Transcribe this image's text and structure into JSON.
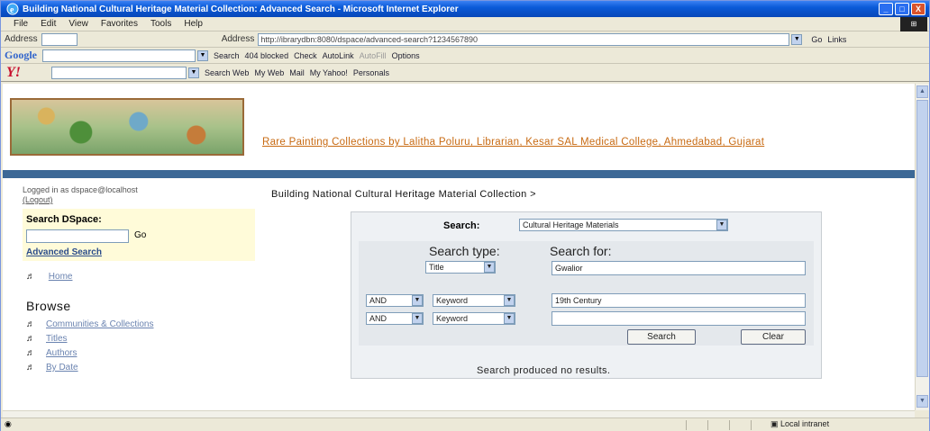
{
  "window": {
    "title": "Building National Cultural Heritage Material Collection: Advanced Search - Microsoft Internet Explorer",
    "buttons": [
      "_",
      "□",
      "X"
    ]
  },
  "menu": [
    "File",
    "Edit",
    "View",
    "Favorites",
    "Tools",
    "Help"
  ],
  "address": {
    "label": "Address",
    "url": "http://ibrarydbn:8080/dspace/advanced-search?1234567890",
    "go_label": "Go",
    "links_label": "Links"
  },
  "google_toolbar": {
    "brand": "Google",
    "items": [
      "Search",
      "404 blocked",
      "Check",
      "AutoLink",
      "AutoFill",
      "Options"
    ]
  },
  "yahoo_toolbar": {
    "brand": "Y!",
    "items": [
      "Search Web",
      "My Web",
      "Mail",
      "My Yahoo!",
      "Personals"
    ]
  },
  "header": {
    "title": "Rare Painting Collections by Lalitha Poluru, Librarian, Kesar SAL Medical College, Ahmedabad, Gujarat"
  },
  "sidebar": {
    "logged_in": "Logged in as dspace@localhost",
    "logout": "(Logout)",
    "search_title": "Search DSpace:",
    "go": "Go",
    "advanced": "Advanced Search",
    "home": "Home",
    "browse_title": "Browse",
    "browse_links": [
      "Communities & Collections",
      "Titles",
      "Authors",
      "By Date"
    ]
  },
  "main": {
    "breadcrumb": "Building National Cultural Heritage Material Collection >",
    "scope_label": "Search:",
    "scope_value": "Cultural Heritage Materials",
    "search_type_label": "Search type:",
    "search_for_label": "Search for:",
    "rows": [
      {
        "conj": "",
        "field": "Title",
        "query": "Gwalior"
      },
      {
        "conj": "AND",
        "field": "Keyword",
        "query": "19th Century"
      },
      {
        "conj": "AND",
        "field": "Keyword",
        "query": ""
      }
    ],
    "search_button": "Search",
    "clear_button": "Clear",
    "result_text": "Search produced no results."
  },
  "status": {
    "zone": "Local intranet"
  }
}
